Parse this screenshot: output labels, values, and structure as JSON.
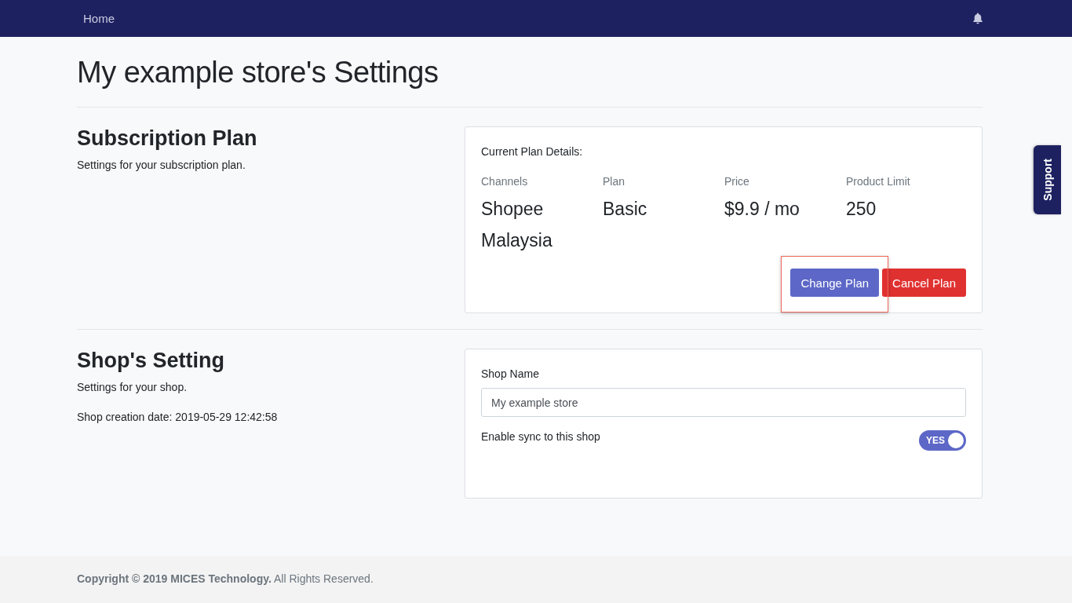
{
  "navbar": {
    "home_link": "Home"
  },
  "page_title": "My example store's Settings",
  "subscription": {
    "heading": "Subscription Plan",
    "description": "Settings for your subscription plan.",
    "card_title": "Current Plan Details:",
    "details": [
      {
        "label": "Channels",
        "value": "Shopee Malaysia"
      },
      {
        "label": "Plan",
        "value": "Basic"
      },
      {
        "label": "Price",
        "value": "$9.9 / mo"
      },
      {
        "label": "Product Limit",
        "value": "250"
      }
    ],
    "buttons": [
      {
        "kind": "primary",
        "label": "Change Plan",
        "highlighted": true
      },
      {
        "kind": "danger",
        "label": "Cancel Plan",
        "highlighted": false
      }
    ]
  },
  "shop": {
    "heading": "Shop's Setting",
    "description": "Settings for your shop.",
    "creation_date": "Shop creation date: 2019-05-29 12:42:58",
    "name_label": "Shop Name",
    "name_value": "My example store",
    "sync": {
      "label": "Enable sync to this shop",
      "on": true,
      "state_text": "YES"
    }
  },
  "footer": {
    "text": "**Copyright © 2019** **MICES Technology.** All Rights Reserved."
  },
  "support_tab": "Support"
}
